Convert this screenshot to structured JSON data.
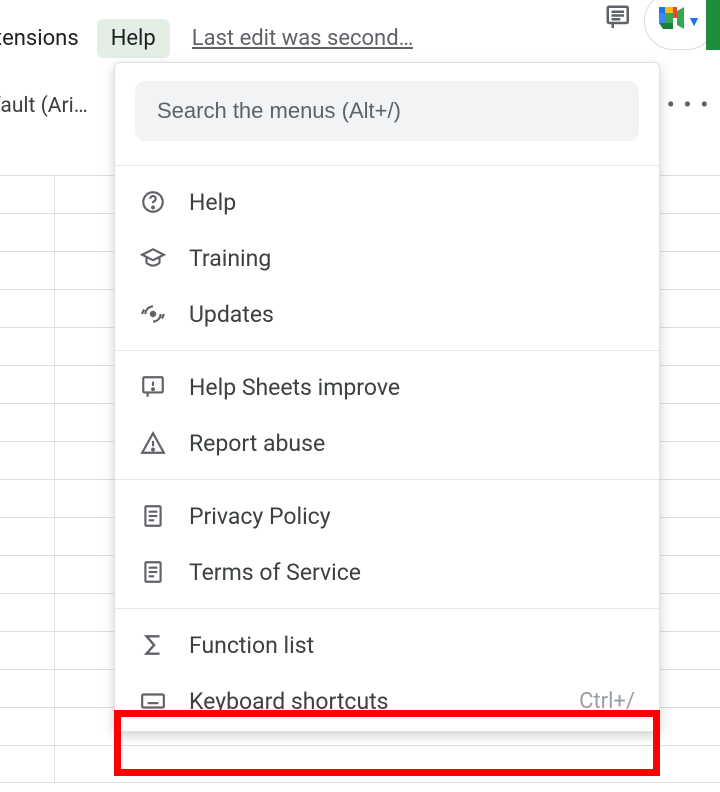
{
  "menubar": {
    "extensions": "xtensions",
    "help": "Help",
    "last_edit": "Last edit was second…"
  },
  "toolbar": {
    "font_name": "efault (Ari…",
    "more": "• • •"
  },
  "help_panel": {
    "search_placeholder": "Search the menus (Alt+/)",
    "group1": [
      {
        "icon": "help-circle-icon",
        "label": "Help"
      },
      {
        "icon": "training-icon",
        "label": "Training"
      },
      {
        "icon": "updates-icon",
        "label": "Updates"
      }
    ],
    "group2": [
      {
        "icon": "feedback-icon",
        "label": "Help Sheets improve"
      },
      {
        "icon": "warning-icon",
        "label": "Report abuse"
      }
    ],
    "group3": [
      {
        "icon": "doc-icon",
        "label": "Privacy Policy"
      },
      {
        "icon": "doc-icon",
        "label": "Terms of Service"
      }
    ],
    "group4": [
      {
        "icon": "sigma-icon",
        "label": "Function list"
      },
      {
        "icon": "keyboard-icon",
        "label": "Keyboard shortcuts",
        "shortcut": "Ctrl+/"
      }
    ]
  }
}
